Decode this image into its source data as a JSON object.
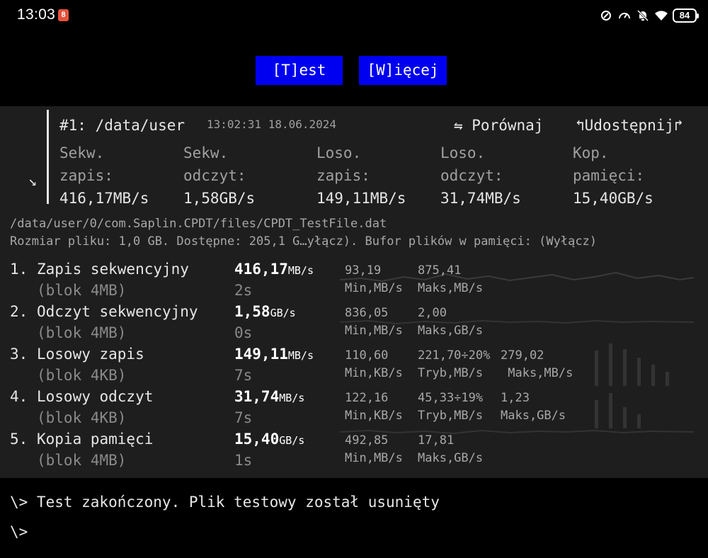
{
  "status_bar": {
    "time": "13:03",
    "notification_badge": "8",
    "battery": "84",
    "icons": [
      "vpn-icon",
      "speedometer-icon",
      "bell-off-icon",
      "wifi-icon"
    ]
  },
  "buttons": {
    "test": "[T]est",
    "more": "[W]ięcej"
  },
  "result": {
    "title": "#1: /data/user",
    "timestamp": "13:02:31 18.06.2024",
    "compare": "⇋ Porównaj",
    "share": "↰Udostępnij↱",
    "expand_icon": "↘",
    "columns": [
      {
        "label1": "Sekw.",
        "label2": "zapis:",
        "value": "416,17MB/s"
      },
      {
        "label1": "Sekw.",
        "label2": "odczyt:",
        "value": "1,58GB/s"
      },
      {
        "label1": "Loso.",
        "label2": "zapis:",
        "value": "149,11MB/s"
      },
      {
        "label1": "Loso.",
        "label2": "odczyt:",
        "value": "31,74MB/s"
      },
      {
        "label1": "Kop.",
        "label2": "pamięci:",
        "value": "15,40GB/s"
      }
    ]
  },
  "file": {
    "path": "/data/user/0/com.Saplin.CPDT/files/CPDT_TestFile.dat",
    "info": "Rozmiar pliku: 1,0 GB. Dostępne: 205,1 G…yłącz). Bufor plików w pamięci: (Wyłącz)"
  },
  "tests": [
    {
      "num": "1.",
      "name": "Zapis sekwencyjny",
      "block": "(blok 4MB)",
      "speed": "416,17",
      "unit": "MB/s",
      "duration": "2s",
      "stats": [
        {
          "v": "93,19",
          "l": "Min,MB/s"
        },
        {
          "v": "875,41",
          "l": "Maks,MB/s"
        }
      ]
    },
    {
      "num": "2.",
      "name": "Odczyt sekwencyjny",
      "block": "(blok 4MB)",
      "speed": "1,58",
      "unit": "GB/s",
      "duration": "0s",
      "stats": [
        {
          "v": "836,05",
          "l": "Min,MB/s"
        },
        {
          "v": "2,00",
          "l": "Maks,GB/s"
        }
      ]
    },
    {
      "num": "3.",
      "name": "Losowy zapis",
      "block": "(blok 4KB)",
      "speed": "149,11",
      "unit": "MB/s",
      "duration": "7s",
      "stats": [
        {
          "v": "110,60",
          "l": "Min,KB/s"
        },
        {
          "v": "221,70÷20%",
          "l": "Tryb,MB/s"
        },
        {
          "v": "279,02",
          "l": " Maks,MB/s"
        }
      ]
    },
    {
      "num": "4.",
      "name": "Losowy odczyt",
      "block": "(blok 4KB)",
      "speed": "31,74",
      "unit": "MB/s",
      "duration": "7s",
      "stats": [
        {
          "v": "122,16",
          "l": "Min,KB/s"
        },
        {
          "v": "45,33÷19%",
          "l": "Tryb,MB/s"
        },
        {
          "v": "1,23",
          "l": "Maks,GB/s"
        }
      ]
    },
    {
      "num": "5.",
      "name": "Kopia pamięci",
      "block": "(blok 4MB)",
      "speed": "15,40",
      "unit": "GB/s",
      "duration": "1s",
      "stats": [
        {
          "v": "492,85",
          "l": "Min,MB/s"
        },
        {
          "v": "17,81",
          "l": "Maks,GB/s"
        }
      ]
    }
  ],
  "console": {
    "line1": "\\> Test zakończony. Plik testowy został usunięty",
    "line2": "\\>"
  }
}
